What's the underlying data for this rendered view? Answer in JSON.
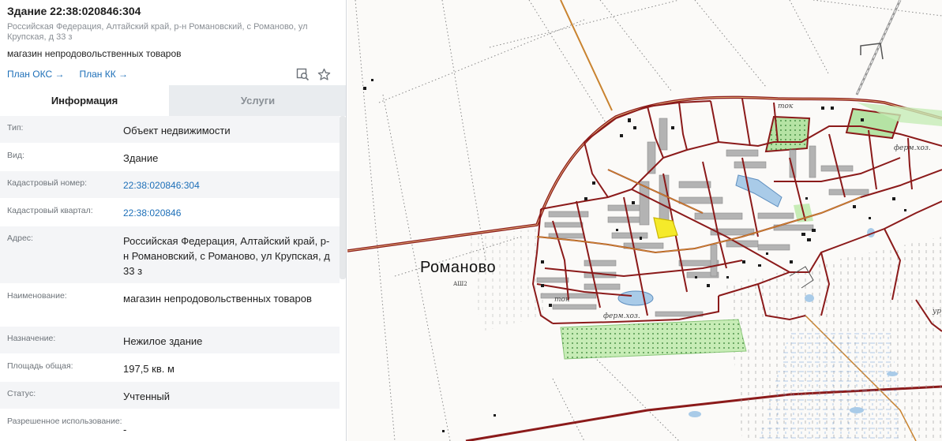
{
  "header": {
    "title": "Здание 22:38:020846:304",
    "address": "Российская Федерация, Алтайский край, р-н Романовский, с Романово, ул Крупская, д 33 з",
    "purpose": "магазин непродовольственных товаров",
    "links": [
      {
        "label": "План ОКС →"
      },
      {
        "label": "План КК →"
      }
    ],
    "icons": [
      "search-map-icon",
      "star-icon"
    ]
  },
  "tabs": [
    {
      "label": "Информация",
      "active": true
    },
    {
      "label": "Услуги",
      "active": false
    }
  ],
  "rows": [
    {
      "label": "Тип:",
      "value": "Объект недвижимости"
    },
    {
      "label": "Вид:",
      "value": "Здание"
    },
    {
      "label": "Кадастровый номер:",
      "value": "22:38:020846:304"
    },
    {
      "label": "Кадастровый квартал:",
      "value": "22:38:020846"
    },
    {
      "label": "Адрес:",
      "value": "Российская Федерация, Алтайский край, р-н Романовский, с Романово, ул Крупская, д 33 з"
    },
    {
      "label": "Наименование:",
      "value": "магазин непродовольственных товаров"
    },
    {
      "label": "Назначение:",
      "value": "Нежилое здание"
    },
    {
      "label": "Площадь общая:",
      "value": "197,5 кв. м"
    },
    {
      "label": "Статус:",
      "value": "Учтенный"
    },
    {
      "label": "Разрешенное использование:",
      "value": "-"
    }
  ],
  "map": {
    "village_name": "Романово",
    "village_code": "АШ2",
    "labels": [
      "ток",
      "ток",
      "ферм.хоз.",
      "ферм.хоз.",
      "ур"
    ],
    "colors": {
      "parcel_border": "#8b1a1a",
      "road": "#c9832f",
      "selected": "#f5ea2a",
      "green_area": "#b5e3a4",
      "water": "#a9cbe8"
    }
  }
}
